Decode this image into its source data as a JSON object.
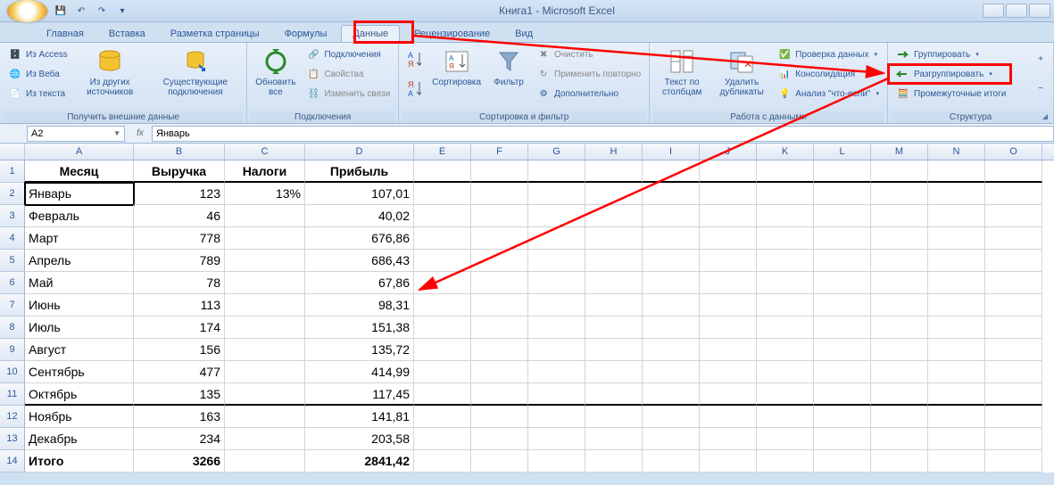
{
  "title": "Книга1 - Microsoft Excel",
  "tabs": [
    "Главная",
    "Вставка",
    "Разметка страницы",
    "Формулы",
    "Данные",
    "Рецензирование",
    "Вид"
  ],
  "activeTab": 4,
  "namebox": "A2",
  "formula": "Январь",
  "ribbon": {
    "g1": {
      "label": "Получить внешние данные",
      "access": "Из Access",
      "web": "Из Веба",
      "text": "Из текста",
      "other": "Из других источников",
      "existing": "Существующие подключения"
    },
    "g2": {
      "label": "Подключения",
      "refresh": "Обновить все",
      "conns": "Подключения",
      "props": "Свойства",
      "links": "Изменить связи"
    },
    "g3": {
      "label": "Сортировка и фильтр",
      "sort": "Сортировка",
      "filter": "Фильтр",
      "clear": "Очистить",
      "reapply": "Применить повторно",
      "adv": "Дополнительно"
    },
    "g4": {
      "label": "Работа с данными",
      "t2c": "Текст по столбцам",
      "dup": "Удалить дубликаты",
      "valid": "Проверка данных",
      "consol": "Консолидация",
      "whatif": "Анализ \"что-если\""
    },
    "g5": {
      "label": "Структура",
      "group": "Группировать",
      "ungroup": "Разгруппировать",
      "sub": "Промежуточные итоги"
    }
  },
  "cols": [
    "A",
    "B",
    "C",
    "D",
    "E",
    "F",
    "G",
    "H",
    "I",
    "J",
    "K",
    "L",
    "M",
    "N",
    "O"
  ],
  "hdr": [
    "Месяц",
    "Выручка",
    "Налоги",
    "Прибыль"
  ],
  "rows": [
    {
      "n": 2,
      "m": "Январь",
      "v": "123",
      "t": "13%",
      "p": "107,01",
      "active": true
    },
    {
      "n": 3,
      "m": "Февраль",
      "v": "46",
      "t": "",
      "p": "40,02"
    },
    {
      "n": 4,
      "m": "Март",
      "v": "778",
      "t": "",
      "p": "676,86"
    },
    {
      "n": 5,
      "m": "Апрель",
      "v": "789",
      "t": "",
      "p": "686,43"
    },
    {
      "n": 6,
      "m": "Май",
      "v": "78",
      "t": "",
      "p": "67,86"
    },
    {
      "n": 7,
      "m": "Июнь",
      "v": "113",
      "t": "",
      "p": "98,31"
    },
    {
      "n": 8,
      "m": "Июль",
      "v": "174",
      "t": "",
      "p": "151,38"
    },
    {
      "n": 9,
      "m": "Август",
      "v": "156",
      "t": "",
      "p": "135,72"
    },
    {
      "n": 10,
      "m": "Сентябрь",
      "v": "477",
      "t": "",
      "p": "414,99"
    },
    {
      "n": 11,
      "m": "Октябрь",
      "v": "135",
      "t": "",
      "p": "117,45",
      "grpend": true
    },
    {
      "n": 12,
      "m": "Ноябрь",
      "v": "163",
      "t": "",
      "p": "141,81"
    },
    {
      "n": 13,
      "m": "Декабрь",
      "v": "234",
      "t": "",
      "p": "203,58"
    },
    {
      "n": 14,
      "m": "Итого",
      "v": "3266",
      "t": "",
      "p": "2841,42",
      "total": true
    }
  ]
}
